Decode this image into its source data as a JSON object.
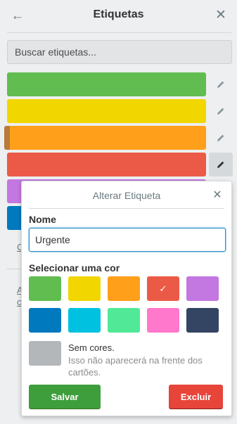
{
  "header": {
    "title": "Etiquetas",
    "back_icon": "←",
    "close_icon": "✕"
  },
  "search": {
    "placeholder": "Buscar etiquetas..."
  },
  "labels": [
    {
      "color": "#61bd4f"
    },
    {
      "color": "#f2d600"
    },
    {
      "color": "#ff9f1a",
      "stripe": "#b77b3a"
    },
    {
      "color": "#eb5a46"
    },
    {
      "color": "#c377e0"
    },
    {
      "color": "#0079bf"
    }
  ],
  "sidebar": {
    "link1": "C",
    "link2a": "A",
    "link2b": "c"
  },
  "popover": {
    "title": "Alterar Etiqueta",
    "close_icon": "✕",
    "name_label": "Nome",
    "name_value": "Urgente",
    "color_label": "Selecionar uma cor",
    "colors": [
      {
        "name": "green",
        "hex": "#61bd4f"
      },
      {
        "name": "yellow",
        "hex": "#f2d600"
      },
      {
        "name": "orange",
        "hex": "#ff9f1a"
      },
      {
        "name": "red",
        "hex": "#eb5a46",
        "selected": true
      },
      {
        "name": "purple",
        "hex": "#c377e0"
      },
      {
        "name": "blue",
        "hex": "#0079bf"
      },
      {
        "name": "sky",
        "hex": "#00c2e0"
      },
      {
        "name": "lime",
        "hex": "#51e898"
      },
      {
        "name": "pink",
        "hex": "#ff78cb"
      },
      {
        "name": "black",
        "hex": "#344563"
      }
    ],
    "selected_mark": "✓",
    "no_color_title": "Sem cores.",
    "no_color_desc": "Isso não aparecerá na frente dos cartões.",
    "save_label": "Salvar",
    "delete_label": "Excluir"
  }
}
